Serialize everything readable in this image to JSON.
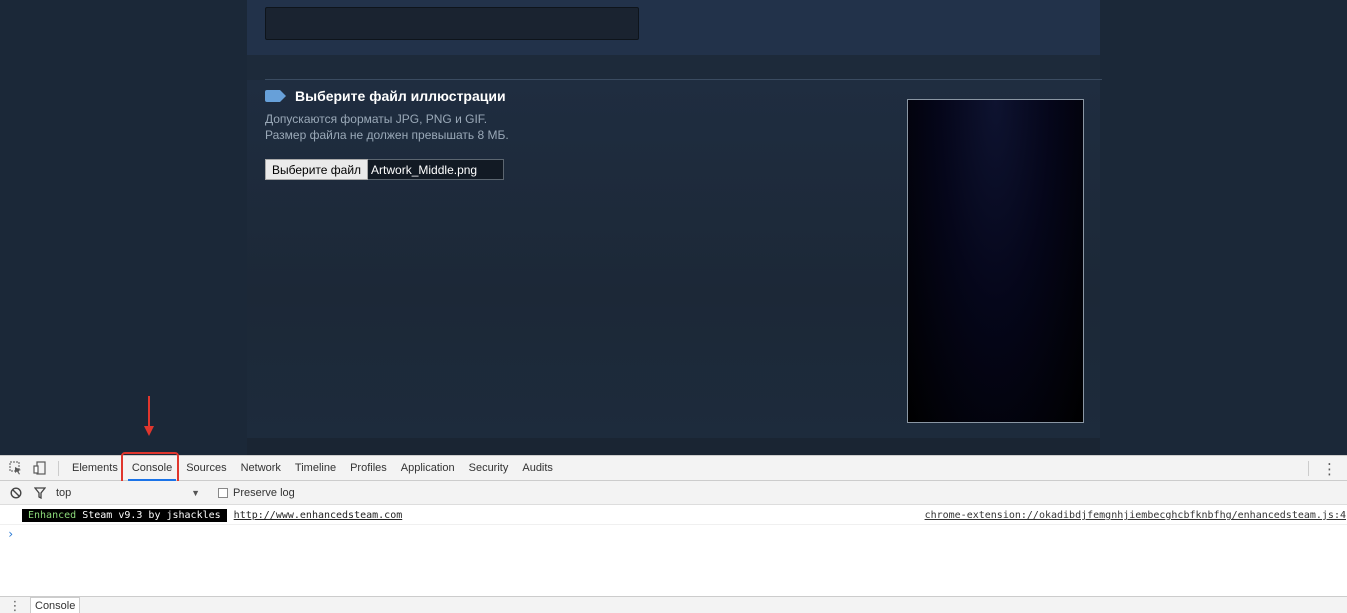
{
  "page": {
    "section_title": "Выберите файл иллюстрации",
    "hint_line1": "Допускаются форматы JPG, PNG и GIF.",
    "hint_line2": "Размер файла не должен превышать 8 МБ.",
    "file_button_label": "Выберите файл",
    "file_name": "Artwork_Middle.png",
    "accent_color": "#67a0d9"
  },
  "devtools": {
    "icons": [
      "inspect-element-icon",
      "device-toolbar-icon",
      "menu-kebab-icon",
      "clear-console-icon",
      "filter-icon"
    ],
    "tabs": [
      {
        "label": "Elements"
      },
      {
        "label": "Console"
      },
      {
        "label": "Sources"
      },
      {
        "label": "Network"
      },
      {
        "label": "Timeline"
      },
      {
        "label": "Profiles"
      },
      {
        "label": "Application"
      },
      {
        "label": "Security"
      },
      {
        "label": "Audits"
      }
    ],
    "active_tab": "Console",
    "context": "top",
    "preserve_log_label": "Preserve log",
    "message": {
      "badge_green": "Enhanced",
      "badge_rest": " Steam v9.3 by jshackles",
      "link": "http://www.enhancedsteam.com",
      "source": "chrome-extension://okadibdjfemgnhjiembecghcbfknbfhg/enhancedsteam.js:4"
    },
    "drawer_tab": "Console",
    "annotation_color": "#e0362d"
  }
}
